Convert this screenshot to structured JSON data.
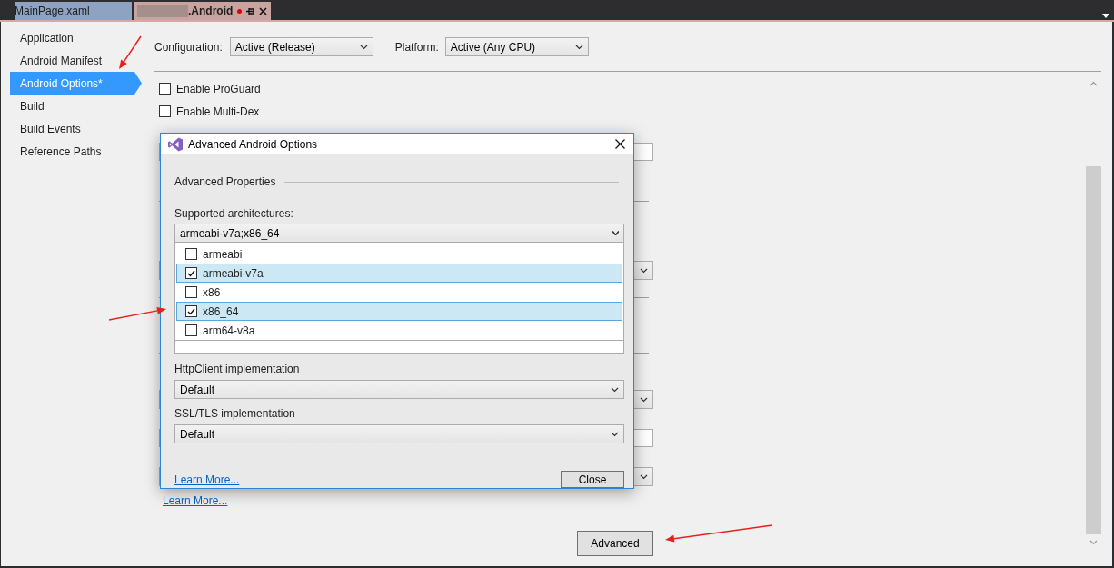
{
  "tabs": [
    {
      "label": "MainPage.xaml",
      "selected": false,
      "modified": false,
      "redacted_prefix": false
    },
    {
      "label": ".Android",
      "selected": true,
      "modified": true,
      "redacted_prefix": true
    }
  ],
  "sidebar": {
    "items": [
      {
        "label": "Application",
        "selected": false
      },
      {
        "label": "Android Manifest",
        "selected": false
      },
      {
        "label": "Android Options*",
        "selected": true
      },
      {
        "label": "Build",
        "selected": false
      },
      {
        "label": "Build Events",
        "selected": false
      },
      {
        "label": "Reference Paths",
        "selected": false
      }
    ]
  },
  "configuration": {
    "label": "Configuration:",
    "value": "Active (Release)"
  },
  "platform": {
    "label": "Platform:",
    "value": "Active (Any CPU)"
  },
  "options": [
    {
      "label": "Enable ProGuard",
      "checked": false
    },
    {
      "label": "Enable Multi-Dex",
      "checked": false
    }
  ],
  "learn_more": "Learn More...",
  "advanced_button": "Advanced",
  "dialog": {
    "title": "Advanced Android Options",
    "section": "Advanced Properties",
    "architectures": {
      "label": "Supported architectures:",
      "value": "armeabi-v7a;x86_64",
      "items": [
        {
          "label": "armeabi",
          "checked": false
        },
        {
          "label": "armeabi-v7a",
          "checked": true
        },
        {
          "label": "x86",
          "checked": false
        },
        {
          "label": "x86_64",
          "checked": true
        },
        {
          "label": "arm64-v8a",
          "checked": false
        }
      ]
    },
    "httpclient": {
      "label": "HttpClient implementation",
      "value": "Default"
    },
    "ssl": {
      "label": "SSL/TLS implementation",
      "value": "Default"
    },
    "learn_more": "Learn More...",
    "close_button": "Close"
  }
}
